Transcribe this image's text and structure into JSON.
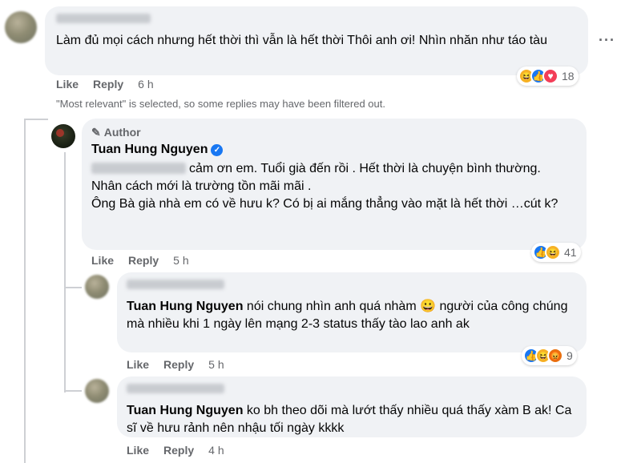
{
  "comment1": {
    "text": "Làm đủ mọi cách nhưng hết thời thì vẫn là hết thời Thôi anh ơi! Nhìn nhăn như táo tàu",
    "like_label": "Like",
    "reply_label": "Reply",
    "time": "6 h",
    "reaction_count": "18",
    "more_icon": "more-dots-icon"
  },
  "filter_note": "\"Most relevant\" is selected, so some replies may have been filtered out.",
  "reply1": {
    "author_tag": "Author",
    "author_name": "Tuan Hung Nguyen",
    "text": "cảm ơn em. Tuổi già đến rồi . Hết thời là chuyện bình thường.\nNhân cách mới là trường tồn mãi mãi .\nÔng Bà già nhà em có về hưu k? Có bị ai mắng thẳng vào mặt là hết thời …cút k?",
    "like_label": "Like",
    "reply_label": "Reply",
    "time": "5 h",
    "reaction_count": "41"
  },
  "reply2": {
    "mention": "Tuan Hung Nguyen",
    "text_before_emoji": "nói chung nhìn anh quá nhàm",
    "emoji": "😀",
    "text_after_emoji": "người của công chúng mà nhiều khi 1 ngày lên mạng 2-3 status thấy tào lao anh ak",
    "like_label": "Like",
    "reply_label": "Reply",
    "time": "5 h",
    "reaction_count": "9"
  },
  "reply3": {
    "mention": "Tuan Hung Nguyen",
    "text": "ko bh theo dõi mà lướt thấy nhiều quá thấy xàm B ak! Ca sĩ về hưu rảnh nên nhậu tối ngày kkkk",
    "like_label": "Like",
    "reply_label": "Reply",
    "time": "4 h"
  },
  "colors": {
    "bubble": "#f0f2f5",
    "meta_text": "#65676b",
    "like_blue": "#1877f2",
    "love_red": "#f33e58",
    "haha_yellow": "#f7b125",
    "angry_orange": "#e9710f"
  }
}
